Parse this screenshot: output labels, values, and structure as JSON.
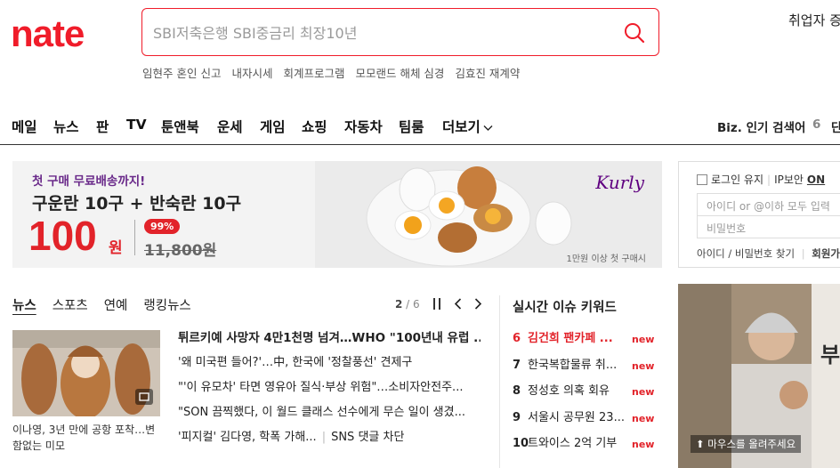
{
  "logo": {
    "text": "nate",
    "color": "#f01c2a"
  },
  "search": {
    "placeholder": "SBI저축은행 SBI중금리 최장10년"
  },
  "hot_keywords": [
    "임현주 혼인 신고",
    "내자시세",
    "회계프로그램",
    "모모랜드 해체 심경",
    "김효진 재계약"
  ],
  "top_right": {
    "text": "취업자 증"
  },
  "gnb": {
    "items": [
      "메일",
      "뉴스",
      "판",
      "TV",
      "툰앤북",
      "운세",
      "게임",
      "쇼핑",
      "자동차",
      "팀룸",
      "더보기"
    ],
    "biz_label": "Biz. 인기 검색어",
    "biz_rank": "6",
    "biz_cut": "단"
  },
  "ad": {
    "line1": "첫 구매 무료배송까지!",
    "line2": "구운란 10구 + 반숙란 10구",
    "price": "100",
    "currency": "원",
    "discount": "99%",
    "original_price": "11,800원",
    "brand": "Kurly",
    "note": "1만원 이상 첫 구매시"
  },
  "login": {
    "keep_login": "로그인 유지",
    "ip_security": "IP보안",
    "ip_on": "ON",
    "id_placeholder": "아이디 or @이하 모두 입력",
    "pw_placeholder": "비밀번호",
    "find_link": "아이디 / 비밀번호 찾기",
    "join_link": "회원가입"
  },
  "news": {
    "tabs": [
      "뉴스",
      "스포츠",
      "연예",
      "랭킹뉴스"
    ],
    "page": "2",
    "total": "6",
    "thumb_caption": "이나영, 3년 만에 공항 포착…변함없는 미모",
    "items": [
      "튀르키예 사망자 4만1천명 넘겨…WHO \"100년내 유럽 ...",
      "'왜 미국편 들어?'…中, 한국에 '정찰풍선' 견제구",
      "\"'이 유모차' 타면 영유아 질식·부상 위험\"…소비자안전주...",
      "\"SON 끔찍했다, 이 월드 클래스 선수에게 무슨 일이 생겼...",
      "'피지컬' 김다영, 학폭 가해..."
    ],
    "extra_item": "SNS 댓글 차단"
  },
  "realtime": {
    "title": "실시간 이슈 키워드",
    "items": [
      {
        "rank": "6",
        "keyword": "김건희 팬카페 ...",
        "badge": "new"
      },
      {
        "rank": "7",
        "keyword": "한국복합물류 취...",
        "badge": "new"
      },
      {
        "rank": "8",
        "keyword": "정성호 의혹 회유",
        "badge": "new"
      },
      {
        "rank": "9",
        "keyword": "서울시 공무원 23...",
        "badge": "new"
      },
      {
        "rank": "10",
        "keyword": "트와이스 2억 기부",
        "badge": "new"
      }
    ]
  },
  "side_ad": {
    "hint": "마우스를 올려주세요",
    "partial_text": "부"
  }
}
